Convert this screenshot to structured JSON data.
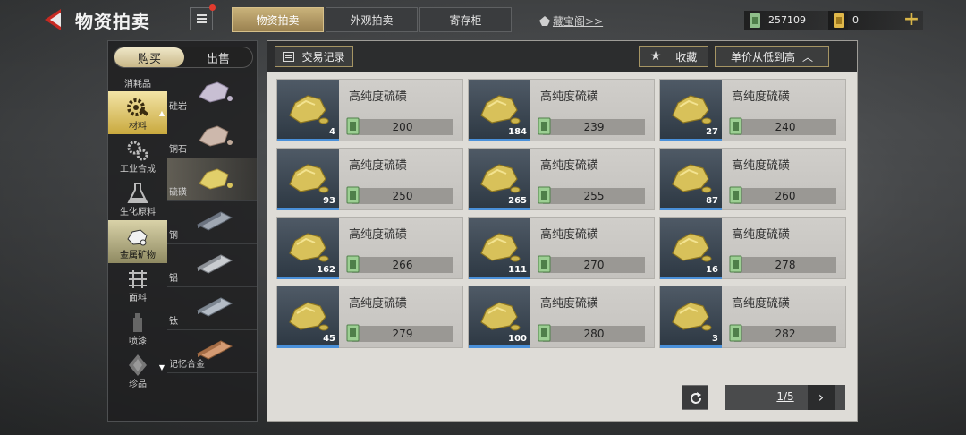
{
  "header": {
    "title": "物资拍卖",
    "tabs": [
      {
        "label": "物资拍卖",
        "active": true
      },
      {
        "label": "外观拍卖",
        "active": false
      },
      {
        "label": "寄存柜",
        "active": false
      }
    ],
    "treasure_link": "藏宝阁>>",
    "currency": {
      "coins": "257109",
      "tickets": "0"
    },
    "plus_label": "+",
    "colors": {
      "accent_gold": "#c9b27a",
      "notification_dot": "#e23b2e",
      "bar_blue": "#4a90d9"
    }
  },
  "side": {
    "trade_toggle": {
      "buy": "购买",
      "sell": "出售",
      "selected": "购买"
    },
    "categories": [
      {
        "label": "消耗品",
        "icon": "consumables-icon"
      },
      {
        "label": "材料",
        "icon": "wrench-gear-icon",
        "active": true
      },
      {
        "label": "工业合成",
        "icon": "gears-icon"
      },
      {
        "label": "生化原料",
        "icon": "flask-icon"
      },
      {
        "label": "金属矿物",
        "icon": "ore-icon",
        "highlight": true
      },
      {
        "label": "面料",
        "icon": "fabric-icon"
      },
      {
        "label": "喷漆",
        "icon": "spray-can-icon"
      },
      {
        "label": "珍品",
        "icon": "diamond-icon"
      }
    ],
    "subcategories": [
      {
        "label": "硅岩"
      },
      {
        "label": "铜石"
      },
      {
        "label": "硫磺",
        "active": true
      },
      {
        "label": "钢"
      },
      {
        "label": "铝"
      },
      {
        "label": "钛"
      },
      {
        "label": "记忆合金"
      }
    ]
  },
  "main": {
    "records_label": "交易记录",
    "favorites_label": "收藏",
    "sort_label": "单价从低到高",
    "items": [
      {
        "name": "高纯度硫磺",
        "qty": "4",
        "price": "200"
      },
      {
        "name": "高纯度硫磺",
        "qty": "184",
        "price": "239"
      },
      {
        "name": "高纯度硫磺",
        "qty": "27",
        "price": "240"
      },
      {
        "name": "高纯度硫磺",
        "qty": "93",
        "price": "250"
      },
      {
        "name": "高纯度硫磺",
        "qty": "265",
        "price": "255"
      },
      {
        "name": "高纯度硫磺",
        "qty": "87",
        "price": "260"
      },
      {
        "name": "高纯度硫磺",
        "qty": "162",
        "price": "266"
      },
      {
        "name": "高纯度硫磺",
        "qty": "111",
        "price": "270"
      },
      {
        "name": "高纯度硫磺",
        "qty": "16",
        "price": "278"
      },
      {
        "name": "高纯度硫磺",
        "qty": "45",
        "price": "279"
      },
      {
        "name": "高纯度硫磺",
        "qty": "100",
        "price": "280"
      },
      {
        "name": "高纯度硫磺",
        "qty": "3",
        "price": "282"
      }
    ],
    "pagination": {
      "current": 1,
      "total": 5,
      "text": "1/5"
    }
  }
}
